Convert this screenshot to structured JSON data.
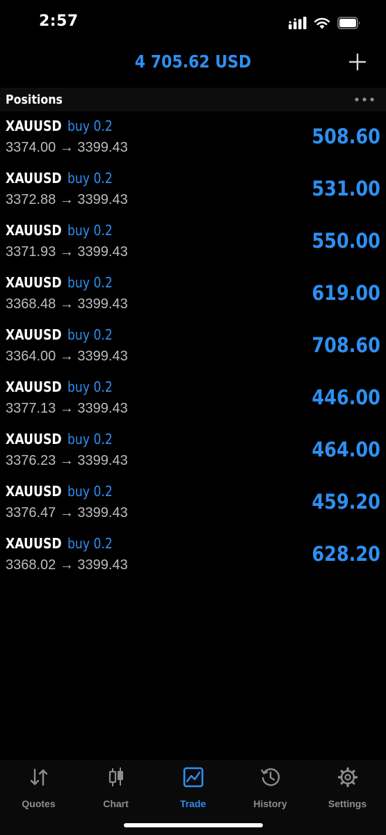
{
  "status": {
    "time": "2:57"
  },
  "header": {
    "balance": "4 705.62 USD"
  },
  "section": {
    "title": "Positions"
  },
  "positions": [
    {
      "symbol": "XAUUSD",
      "type": "buy 0.2",
      "open": "3374.00",
      "arrow": "→",
      "current": "3399.43",
      "profit": "508.60"
    },
    {
      "symbol": "XAUUSD",
      "type": "buy 0.2",
      "open": "3372.88",
      "arrow": "→",
      "current": "3399.43",
      "profit": "531.00"
    },
    {
      "symbol": "XAUUSD",
      "type": "buy 0.2",
      "open": "3371.93",
      "arrow": "→",
      "current": "3399.43",
      "profit": "550.00"
    },
    {
      "symbol": "XAUUSD",
      "type": "buy 0.2",
      "open": "3368.48",
      "arrow": "→",
      "current": "3399.43",
      "profit": "619.00"
    },
    {
      "symbol": "XAUUSD",
      "type": "buy 0.2",
      "open": "3364.00",
      "arrow": "→",
      "current": "3399.43",
      "profit": "708.60"
    },
    {
      "symbol": "XAUUSD",
      "type": "buy 0.2",
      "open": "3377.13",
      "arrow": "→",
      "current": "3399.43",
      "profit": "446.00"
    },
    {
      "symbol": "XAUUSD",
      "type": "buy 0.2",
      "open": "3376.23",
      "arrow": "→",
      "current": "3399.43",
      "profit": "464.00"
    },
    {
      "symbol": "XAUUSD",
      "type": "buy 0.2",
      "open": "3376.47",
      "arrow": "→",
      "current": "3399.43",
      "profit": "459.20"
    },
    {
      "symbol": "XAUUSD",
      "type": "buy 0.2",
      "open": "3368.02",
      "arrow": "→",
      "current": "3399.43",
      "profit": "628.20"
    }
  ],
  "tabs": [
    {
      "label": "Quotes",
      "icon": "quotes-arrows-icon"
    },
    {
      "label": "Chart",
      "icon": "candlestick-chart-icon"
    },
    {
      "label": "Trade",
      "icon": "trade-line-chart-icon",
      "active": true
    },
    {
      "label": "History",
      "icon": "history-clock-icon"
    },
    {
      "label": "Settings",
      "icon": "gear-icon"
    }
  ],
  "colors": {
    "accent": "#2e8ff2",
    "background": "#000000",
    "inactive": "#8e8e8e"
  }
}
